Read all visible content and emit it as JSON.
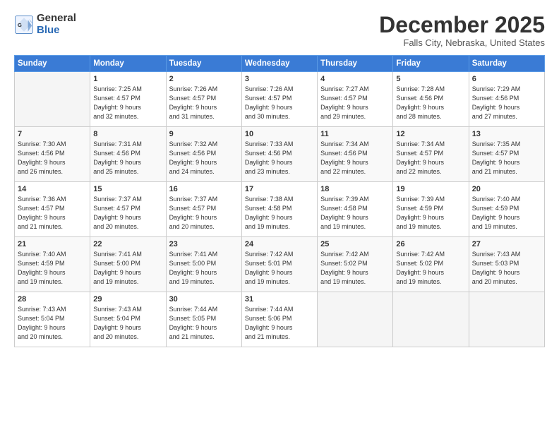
{
  "logo": {
    "general": "General",
    "blue": "Blue"
  },
  "title": "December 2025",
  "subtitle": "Falls City, Nebraska, United States",
  "days_of_week": [
    "Sunday",
    "Monday",
    "Tuesday",
    "Wednesday",
    "Thursday",
    "Friday",
    "Saturday"
  ],
  "weeks": [
    [
      {
        "day": "",
        "info": ""
      },
      {
        "day": "1",
        "info": "Sunrise: 7:25 AM\nSunset: 4:57 PM\nDaylight: 9 hours\nand 32 minutes."
      },
      {
        "day": "2",
        "info": "Sunrise: 7:26 AM\nSunset: 4:57 PM\nDaylight: 9 hours\nand 31 minutes."
      },
      {
        "day": "3",
        "info": "Sunrise: 7:26 AM\nSunset: 4:57 PM\nDaylight: 9 hours\nand 30 minutes."
      },
      {
        "day": "4",
        "info": "Sunrise: 7:27 AM\nSunset: 4:57 PM\nDaylight: 9 hours\nand 29 minutes."
      },
      {
        "day": "5",
        "info": "Sunrise: 7:28 AM\nSunset: 4:56 PM\nDaylight: 9 hours\nand 28 minutes."
      },
      {
        "day": "6",
        "info": "Sunrise: 7:29 AM\nSunset: 4:56 PM\nDaylight: 9 hours\nand 27 minutes."
      }
    ],
    [
      {
        "day": "7",
        "info": "Sunrise: 7:30 AM\nSunset: 4:56 PM\nDaylight: 9 hours\nand 26 minutes."
      },
      {
        "day": "8",
        "info": "Sunrise: 7:31 AM\nSunset: 4:56 PM\nDaylight: 9 hours\nand 25 minutes."
      },
      {
        "day": "9",
        "info": "Sunrise: 7:32 AM\nSunset: 4:56 PM\nDaylight: 9 hours\nand 24 minutes."
      },
      {
        "day": "10",
        "info": "Sunrise: 7:33 AM\nSunset: 4:56 PM\nDaylight: 9 hours\nand 23 minutes."
      },
      {
        "day": "11",
        "info": "Sunrise: 7:34 AM\nSunset: 4:56 PM\nDaylight: 9 hours\nand 22 minutes."
      },
      {
        "day": "12",
        "info": "Sunrise: 7:34 AM\nSunset: 4:57 PM\nDaylight: 9 hours\nand 22 minutes."
      },
      {
        "day": "13",
        "info": "Sunrise: 7:35 AM\nSunset: 4:57 PM\nDaylight: 9 hours\nand 21 minutes."
      }
    ],
    [
      {
        "day": "14",
        "info": "Sunrise: 7:36 AM\nSunset: 4:57 PM\nDaylight: 9 hours\nand 21 minutes."
      },
      {
        "day": "15",
        "info": "Sunrise: 7:37 AM\nSunset: 4:57 PM\nDaylight: 9 hours\nand 20 minutes."
      },
      {
        "day": "16",
        "info": "Sunrise: 7:37 AM\nSunset: 4:57 PM\nDaylight: 9 hours\nand 20 minutes."
      },
      {
        "day": "17",
        "info": "Sunrise: 7:38 AM\nSunset: 4:58 PM\nDaylight: 9 hours\nand 19 minutes."
      },
      {
        "day": "18",
        "info": "Sunrise: 7:39 AM\nSunset: 4:58 PM\nDaylight: 9 hours\nand 19 minutes."
      },
      {
        "day": "19",
        "info": "Sunrise: 7:39 AM\nSunset: 4:59 PM\nDaylight: 9 hours\nand 19 minutes."
      },
      {
        "day": "20",
        "info": "Sunrise: 7:40 AM\nSunset: 4:59 PM\nDaylight: 9 hours\nand 19 minutes."
      }
    ],
    [
      {
        "day": "21",
        "info": "Sunrise: 7:40 AM\nSunset: 4:59 PM\nDaylight: 9 hours\nand 19 minutes."
      },
      {
        "day": "22",
        "info": "Sunrise: 7:41 AM\nSunset: 5:00 PM\nDaylight: 9 hours\nand 19 minutes."
      },
      {
        "day": "23",
        "info": "Sunrise: 7:41 AM\nSunset: 5:00 PM\nDaylight: 9 hours\nand 19 minutes."
      },
      {
        "day": "24",
        "info": "Sunrise: 7:42 AM\nSunset: 5:01 PM\nDaylight: 9 hours\nand 19 minutes."
      },
      {
        "day": "25",
        "info": "Sunrise: 7:42 AM\nSunset: 5:02 PM\nDaylight: 9 hours\nand 19 minutes."
      },
      {
        "day": "26",
        "info": "Sunrise: 7:42 AM\nSunset: 5:02 PM\nDaylight: 9 hours\nand 19 minutes."
      },
      {
        "day": "27",
        "info": "Sunrise: 7:43 AM\nSunset: 5:03 PM\nDaylight: 9 hours\nand 20 minutes."
      }
    ],
    [
      {
        "day": "28",
        "info": "Sunrise: 7:43 AM\nSunset: 5:04 PM\nDaylight: 9 hours\nand 20 minutes."
      },
      {
        "day": "29",
        "info": "Sunrise: 7:43 AM\nSunset: 5:04 PM\nDaylight: 9 hours\nand 20 minutes."
      },
      {
        "day": "30",
        "info": "Sunrise: 7:44 AM\nSunset: 5:05 PM\nDaylight: 9 hours\nand 21 minutes."
      },
      {
        "day": "31",
        "info": "Sunrise: 7:44 AM\nSunset: 5:06 PM\nDaylight: 9 hours\nand 21 minutes."
      },
      {
        "day": "",
        "info": ""
      },
      {
        "day": "",
        "info": ""
      },
      {
        "day": "",
        "info": ""
      }
    ]
  ]
}
